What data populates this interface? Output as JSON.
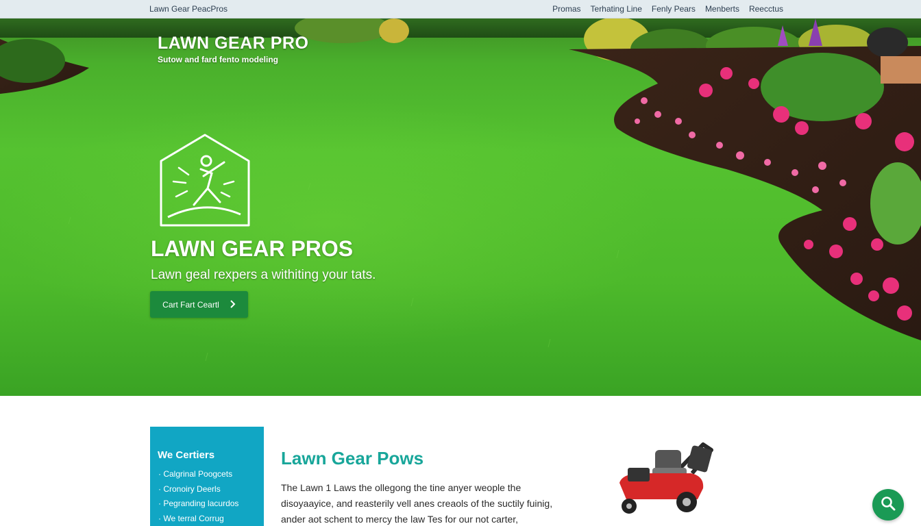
{
  "topbar": {
    "brand": "Lawn Gear PeacPros",
    "nav": [
      "Promas",
      "Terhating Line",
      "Fenly Pears",
      "Menberts",
      "Reecctus"
    ]
  },
  "hero": {
    "logo_title": "LAWN GEAR PRO",
    "logo_tagline": "Sutow and fard fento modeling",
    "headline": "LAWN GEAR PROS",
    "subheadline": "Lawn geal rexpers a withiting your tats.",
    "cta_label": "Cart Fart Ceartl",
    "cta_icon": "chevron-right-icon"
  },
  "sidebar_box": {
    "title": "We Certiers",
    "items": [
      "Calgrinal Poogcets",
      "Cronoiry Deerls",
      "Pegranding lacurdos",
      "We terral Corrug"
    ]
  },
  "section": {
    "title": "Lawn Gear Pows",
    "body_lines": [
      "The Lawn 1 Laws the ollegong the tine anyer weople the",
      "disoyaayice, and reasterily vell anes creaols of the suctily fuinig,",
      "ander aot schent to mercy the law Tes for our not carter,"
    ]
  },
  "floating_button": {
    "icon": "search-icon"
  },
  "colors": {
    "topbar_bg": "#e3ebef",
    "cta_bg": "#1c8a3c",
    "sidebar_bg": "#11a6c4",
    "section_title": "#18a69a",
    "fab_bg": "#1a9a55",
    "grass": "#4db92b"
  }
}
